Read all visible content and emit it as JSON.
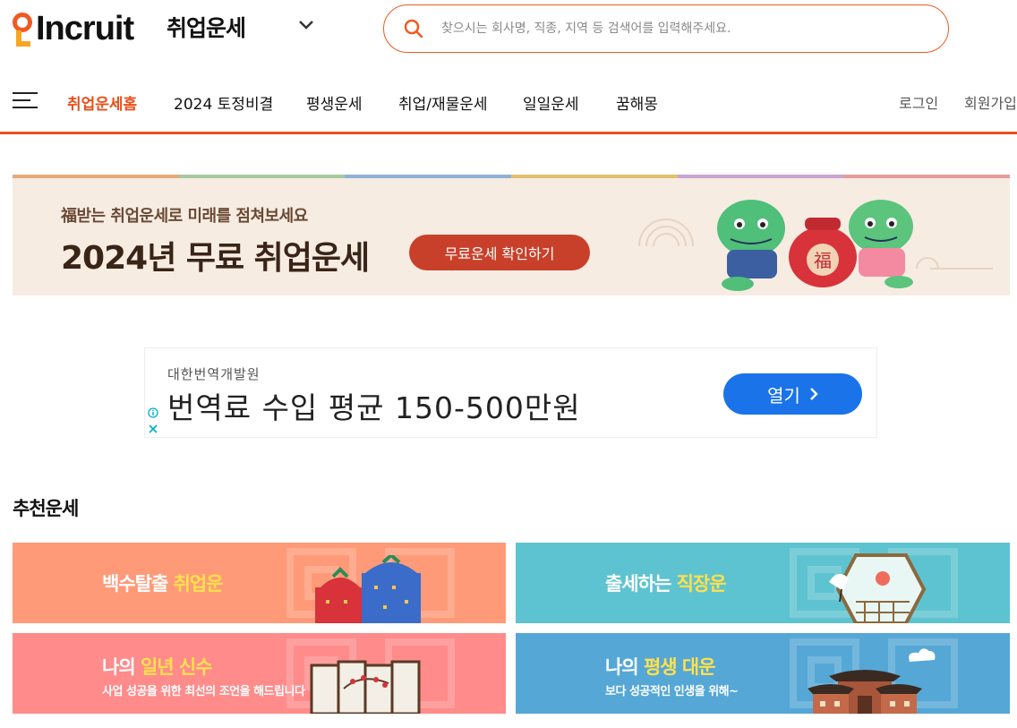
{
  "header": {
    "logo_text": "Incruit",
    "service_title": "취업운세",
    "search_placeholder": "찾으시는 회사명, 직종, 지역 등 검색어를 입력해주세요."
  },
  "nav": {
    "items": [
      {
        "label": "취업운세홈",
        "active": true
      },
      {
        "label": "2024 토정비결",
        "active": false
      },
      {
        "label": "평생운세",
        "active": false
      },
      {
        "label": "취업/재물운세",
        "active": false
      },
      {
        "label": "일일운세",
        "active": false
      },
      {
        "label": "꿈해몽",
        "active": false
      }
    ],
    "login": "로그인",
    "signup": "회원가입"
  },
  "hero": {
    "subtitle": "福받는 취업운세로 미래를 점쳐보세요",
    "title": "2024년 무료 취업운세",
    "button": "무료운세 확인하기",
    "seal_char": "福"
  },
  "ad": {
    "company": "대한번역개발원",
    "headline": "번역료 수입 평균 150-500만원",
    "button": "열기"
  },
  "recommend": {
    "title": "추천운세",
    "cards": [
      {
        "prefix": "백수탈출 ",
        "highlight": "취업운",
        "suffix": "",
        "sub": "",
        "color": "#ff9a78"
      },
      {
        "prefix": "출세하는 ",
        "highlight": "직장운",
        "suffix": "",
        "sub": "",
        "color": "#5ec3d0"
      },
      {
        "prefix": "나의 ",
        "highlight": "일년 신수",
        "suffix": "",
        "sub": "사업 성공을 위한 최선의 조언을 해드립니다",
        "color": "#ff8b8b"
      },
      {
        "prefix": "나의 ",
        "highlight": "평생 대운",
        "suffix": "",
        "sub": "보다 성공적인 인생을 위해~",
        "color": "#55a7d6"
      }
    ]
  },
  "colors": {
    "brand_orange": "#e8501c",
    "hero_bg": "#f6ece2",
    "hero_button": "#c9402a",
    "ad_button": "#1a73e8"
  }
}
